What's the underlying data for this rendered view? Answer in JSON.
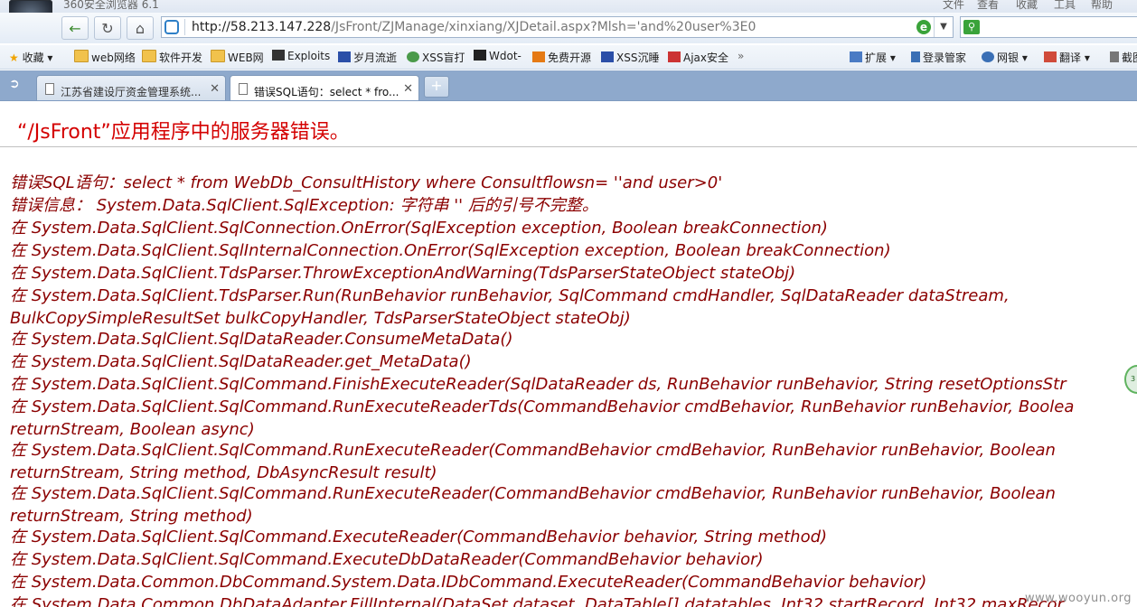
{
  "browser": {
    "title": "360安全浏览器 6.1",
    "menus": [
      "文件",
      "查看",
      "收藏",
      "工具",
      "帮助"
    ],
    "address": {
      "url_host": "http://58.213.147.228",
      "url_path": "/JsFront/ZJManage/xinxiang/XJDetail.aspx?Mlsh='and%20user%3E0"
    }
  },
  "bookmarks": {
    "favorites": "收藏",
    "items": [
      "web网络",
      "软件开发",
      "WEB网",
      "Exploits",
      "岁月流逝",
      "XSS盲打",
      "Wdot-",
      "免费开源",
      "XSS沉睡",
      "Ajax安全"
    ],
    "more": "»",
    "right_items": [
      "扩展",
      "登录管家",
      "网银",
      "翻译",
      "截图"
    ]
  },
  "tabs": [
    {
      "label": "江苏省建设厅资金管理系统..."
    },
    {
      "label": "错误SQL语句：select * fro..."
    }
  ],
  "page": {
    "heading": "“/JsFront”应用程序中的服务器错误。",
    "error_lines": [
      "错误SQL语句：select * from WebDb_ConsultHistory where Consultflowsn= ''and user>0'",
      "错误信息：  System.Data.SqlClient.SqlException: 字符串 '' 后的引号不完整。",
      "  在 System.Data.SqlClient.SqlConnection.OnError(SqlException exception, Boolean breakConnection)",
      "  在 System.Data.SqlClient.SqlInternalConnection.OnError(SqlException exception, Boolean breakConnection)",
      "  在 System.Data.SqlClient.TdsParser.ThrowExceptionAndWarning(TdsParserStateObject stateObj)",
      "  在 System.Data.SqlClient.TdsParser.Run(RunBehavior runBehavior, SqlCommand cmdHandler, SqlDataReader dataStream,",
      "BulkCopySimpleResultSet bulkCopyHandler, TdsParserStateObject stateObj)",
      "  在 System.Data.SqlClient.SqlDataReader.ConsumeMetaData()",
      "  在 System.Data.SqlClient.SqlDataReader.get_MetaData()",
      "  在 System.Data.SqlClient.SqlCommand.FinishExecuteReader(SqlDataReader ds, RunBehavior runBehavior, String resetOptionsStr",
      "  在 System.Data.SqlClient.SqlCommand.RunExecuteReaderTds(CommandBehavior cmdBehavior, RunBehavior runBehavior, Boolea",
      "returnStream, Boolean async)",
      "  在 System.Data.SqlClient.SqlCommand.RunExecuteReader(CommandBehavior cmdBehavior, RunBehavior runBehavior, Boolean",
      "returnStream, String method, DbAsyncResult result)",
      "  在 System.Data.SqlClient.SqlCommand.RunExecuteReader(CommandBehavior cmdBehavior, RunBehavior runBehavior, Boolean",
      "returnStream, String method)",
      "  在 System.Data.SqlClient.SqlCommand.ExecuteReader(CommandBehavior behavior, String method)",
      "  在 System.Data.SqlClient.SqlCommand.ExecuteDbDataReader(CommandBehavior behavior)",
      "  在 System.Data.Common.DbCommand.System.Data.IDbCommand.ExecuteReader(CommandBehavior behavior)",
      "  在 System.Data.Common.DbDataAdapter.FillInternal(DataSet dataset, DataTable[] datatables, Int32 startRecord, Int32 maxRecor"
    ]
  },
  "watermark": "www.wooyun.org",
  "colors": {
    "error_text": "#8b0000",
    "heading": "#d40000"
  }
}
